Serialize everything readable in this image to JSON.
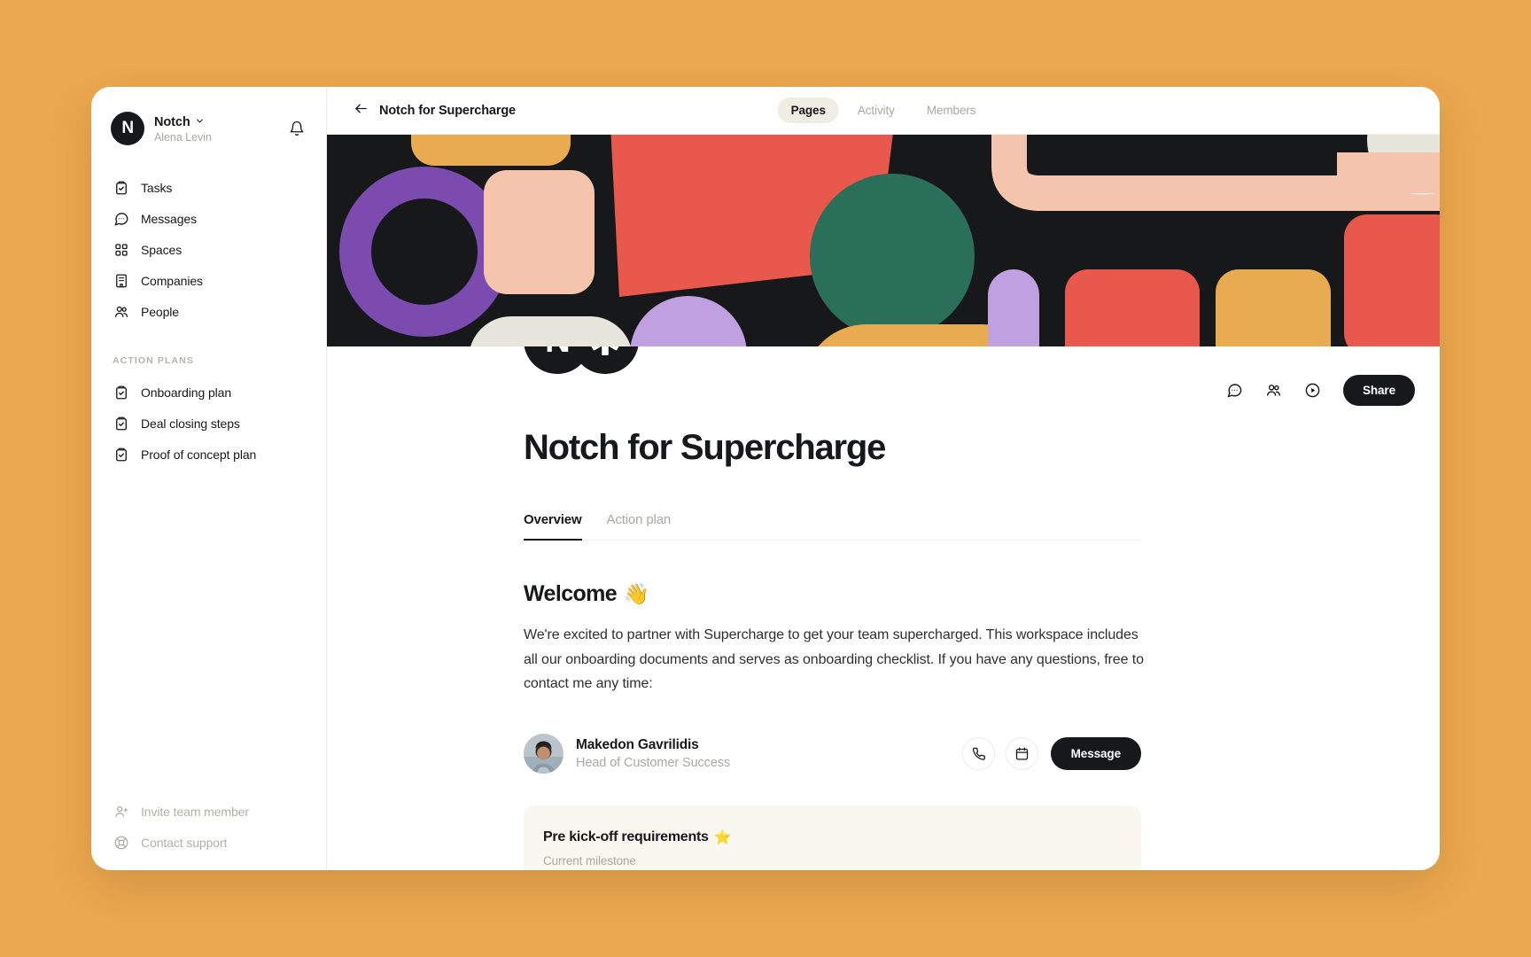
{
  "theme": {
    "page_background": "#eba84f",
    "window_background": "#ffffff",
    "accent_dark": "#17181a",
    "muted_text": "#a9a9a4",
    "active_tab_pill": "#eeeee5",
    "card_background": "#f8f8f1"
  },
  "sidebar": {
    "workspace": {
      "avatar_letter": "N",
      "name": "Notch",
      "user": "Alena Levin",
      "caret_icon": "chevron-down-icon",
      "bell_icon": "bell-icon"
    },
    "nav": [
      {
        "label": "Tasks",
        "icon": "clipboard-check-icon"
      },
      {
        "label": "Messages",
        "icon": "chat-bubble-icon"
      },
      {
        "label": "Spaces",
        "icon": "grid-dots-icon"
      },
      {
        "label": "Companies",
        "icon": "building-icon"
      },
      {
        "label": "People",
        "icon": "people-icon"
      }
    ],
    "section_title": "ACTION PLANS",
    "action_plans": [
      {
        "label": "Onboarding plan",
        "icon": "clipboard-check-icon"
      },
      {
        "label": "Deal closing steps",
        "icon": "clipboard-check-icon"
      },
      {
        "label": "Proof of concept plan",
        "icon": "clipboard-check-icon"
      }
    ],
    "footer": [
      {
        "label": "Invite team member",
        "icon": "person-plus-icon"
      },
      {
        "label": "Contact support",
        "icon": "lifebuoy-icon"
      }
    ]
  },
  "topbar": {
    "back_icon": "arrow-left-icon",
    "breadcrumb": "Notch for Supercharge",
    "tabs": [
      {
        "label": "Pages",
        "active": true
      },
      {
        "label": "Activity",
        "active": false
      },
      {
        "label": "Members",
        "active": false
      }
    ]
  },
  "document": {
    "logo_badges": [
      {
        "glyph": "N",
        "name": "notch-logo-badge"
      },
      {
        "glyph": "asterisk",
        "name": "supercharge-logo-badge"
      }
    ],
    "actions": {
      "comment_icon": "chat-bubble-icon",
      "members_icon": "people-icon",
      "play_icon": "play-circle-icon",
      "share_label": "Share"
    },
    "title": "Notch for Supercharge",
    "tabs": [
      {
        "label": "Overview",
        "active": true
      },
      {
        "label": "Action plan",
        "active": false
      }
    ],
    "welcome": {
      "heading": "Welcome",
      "emoji": "👋",
      "body": "We're excited to partner with Supercharge to get your team supercharged. This workspace includes all our onboarding documents and serves as onboarding checklist. If you have any questions, free to contact me any time:"
    },
    "contact": {
      "name": "Makedon Gavrilidis",
      "role": "Head of Customer Success",
      "avatar": "person-photo-avatar",
      "call_icon": "phone-icon",
      "calendar_icon": "calendar-icon",
      "message_label": "Message"
    },
    "milestone": {
      "title": "Pre kick-off requirements",
      "emoji": "⭐",
      "subtitle": "Current milestone"
    }
  },
  "banner": {
    "background": "#16181a",
    "colors": {
      "purple": "#7b4bb0",
      "amber": "#e9ab50",
      "peach": "#f5c4ac",
      "red": "#e8584c",
      "lavender": "#c0a0e0",
      "green": "#2a6f57",
      "cream": "#e6e6dd"
    }
  }
}
